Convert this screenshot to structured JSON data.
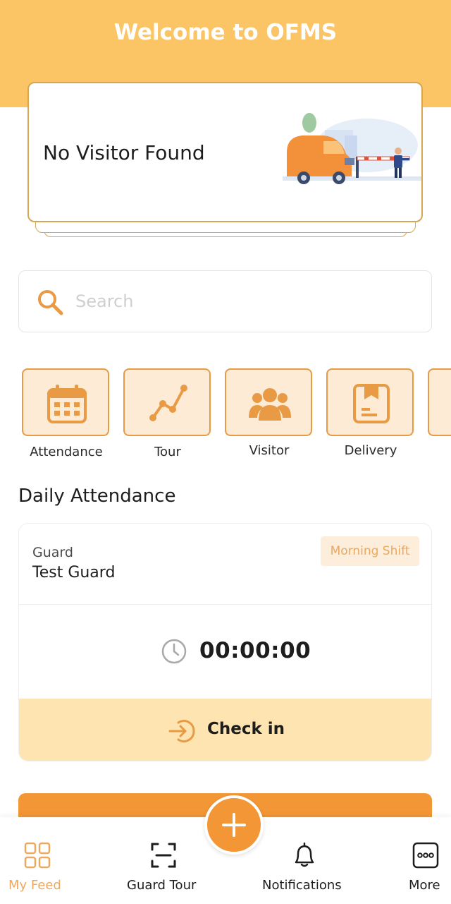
{
  "header": {
    "title": "Welcome to OFMS"
  },
  "visitor_card": {
    "message": "No Visitor Found"
  },
  "search": {
    "placeholder": "Search",
    "value": ""
  },
  "quick_actions": [
    {
      "label": "Attendance",
      "icon": "calendar-icon"
    },
    {
      "label": "Tour",
      "icon": "route-icon"
    },
    {
      "label": "Visitor",
      "icon": "visitors-icon"
    },
    {
      "label": "Delivery",
      "icon": "package-icon"
    }
  ],
  "daily_attendance": {
    "title": "Daily Attendance",
    "role": "Guard",
    "name": "Test Guard",
    "shift": "Morning Shift",
    "timer": "00:00:00",
    "check_in_label": "Check in"
  },
  "primary_button": {
    "label": ""
  },
  "bottom_nav": {
    "items": [
      {
        "label": "My Feed",
        "icon": "grid-icon",
        "active": true
      },
      {
        "label": "Guard Tour",
        "icon": "scan-icon",
        "active": false
      },
      {
        "label": "Notifications",
        "icon": "bell-icon",
        "active": false
      },
      {
        "label": "More",
        "icon": "more-icon",
        "active": false
      }
    ],
    "fab_icon": "plus-icon"
  },
  "colors": {
    "header": "#fbc565",
    "accent": "#f29636",
    "tile_bg": "#fdebd5",
    "tile_border": "#e89a45",
    "card_border": "#d8a653",
    "checkin_bg": "#fde4b0",
    "active_nav": "#eba960"
  }
}
